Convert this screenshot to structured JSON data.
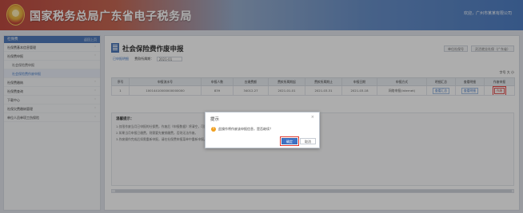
{
  "header": {
    "title": "国家税务总局广东省电子税务局",
    "user_info": "欢迎，广州市某某有限公司"
  },
  "sidebar": {
    "head_label": "社保费",
    "head_link": "返回上页",
    "items": [
      {
        "label": "社保费基本信息管理",
        "arrow": "˅"
      },
      {
        "label": "社保费申报",
        "arrow": "˅"
      },
      {
        "label": "社会保险费申报",
        "sub": true
      },
      {
        "label": "社会保险费作废申报",
        "sub": true,
        "active": true
      },
      {
        "label": "社保费缴纳",
        "arrow": "˅"
      },
      {
        "label": "社保费查询",
        "arrow": "˅"
      },
      {
        "label": "下载中心",
        "arrow": "˅"
      },
      {
        "label": "社保欠费缴纳管理",
        "arrow": "˅"
      },
      {
        "label": "单位人员单项工伤保险",
        "arrow": "˅"
      }
    ]
  },
  "main": {
    "title": "社会保险费作废申报",
    "head_buttons": [
      "单位社保号",
      "灵活就业社保（广东省）"
    ],
    "filter": {
      "tab": "已申报明细",
      "period_label": "费款所属期：",
      "period_value": "2021-01"
    },
    "font_ctl": "字号  大  小",
    "table": {
      "headers": [
        "序号",
        "申报流水号",
        "申报人数",
        "应缴费额",
        "费款所属期起",
        "费款所属期止",
        "申报日期",
        "申报方式",
        "明细汇总",
        "查看明细",
        "作废申报"
      ],
      "rows": [
        [
          "1",
          "10014410000000000000",
          "839",
          "34012.27",
          "2021-01-01",
          "2021-03-31",
          "2021-03-18",
          "网络申报(Internet)",
          "查看汇总",
          "查看明细",
          "作废"
        ]
      ]
    },
    "tips": {
      "title": "温馨提示：",
      "lines": [
        "1.仅限作废当月已申报的社保费，作废后《申报数据》将清空，可重新申报。",
        "2.如果当月申报已缴费，则需要先撤销缴费，否则无法作废。",
        "3.作废操作完成后如需重新申报，请在社保费申报菜单中重新申报。"
      ]
    }
  },
  "dialog": {
    "title": "提示",
    "close": "×",
    "icon": "!",
    "message": "此操作将作废该申报信息，是否继续？",
    "confirm": "确定",
    "cancel": "取消"
  }
}
